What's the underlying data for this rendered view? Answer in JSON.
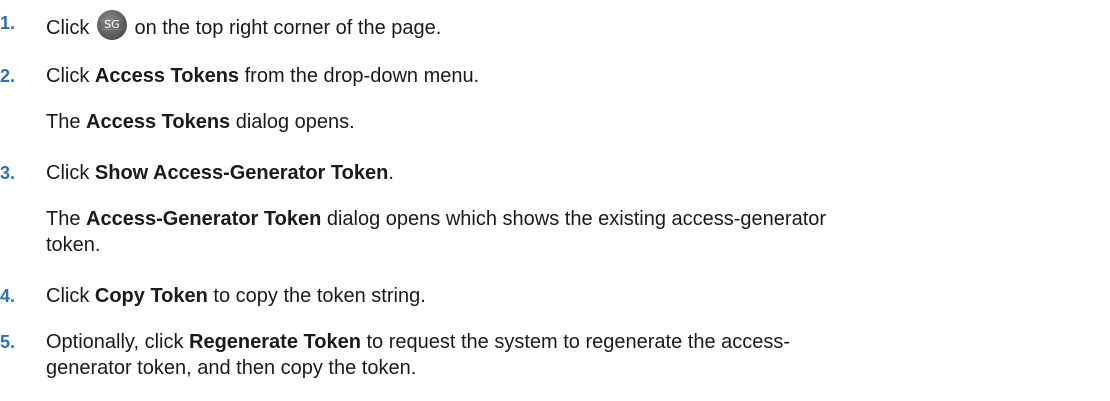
{
  "steps": [
    {
      "number": "1.",
      "pre": "Click ",
      "icon_label": "SG",
      "icon_name": "user-avatar-icon",
      "post": " on the top right corner of the page."
    },
    {
      "number": "2.",
      "pre": "Click ",
      "bold": "Access Tokens",
      "post": " from the drop-down menu.",
      "result": {
        "pre": "The ",
        "bold": "Access Tokens",
        "post": " dialog opens."
      }
    },
    {
      "number": "3.",
      "pre": "Click ",
      "bold": "Show Access-Generator Token",
      "post": ".",
      "result": {
        "pre": "The ",
        "bold": "Access-Generator Token",
        "post_line1": " dialog opens which shows the existing access-generator",
        "post_line2": "token."
      }
    },
    {
      "number": "4.",
      "pre": "Click ",
      "bold": "Copy Token",
      "post": " to copy the token string."
    },
    {
      "number": "5.",
      "pre": "Optionally, click ",
      "bold": "Regenerate Token",
      "post_line1": " to request the system to regenerate the access-",
      "post_line2": "generator token, and then copy the token."
    }
  ],
  "colors": {
    "step_number": "#2f6fb3",
    "text": "#1a1a1a"
  }
}
